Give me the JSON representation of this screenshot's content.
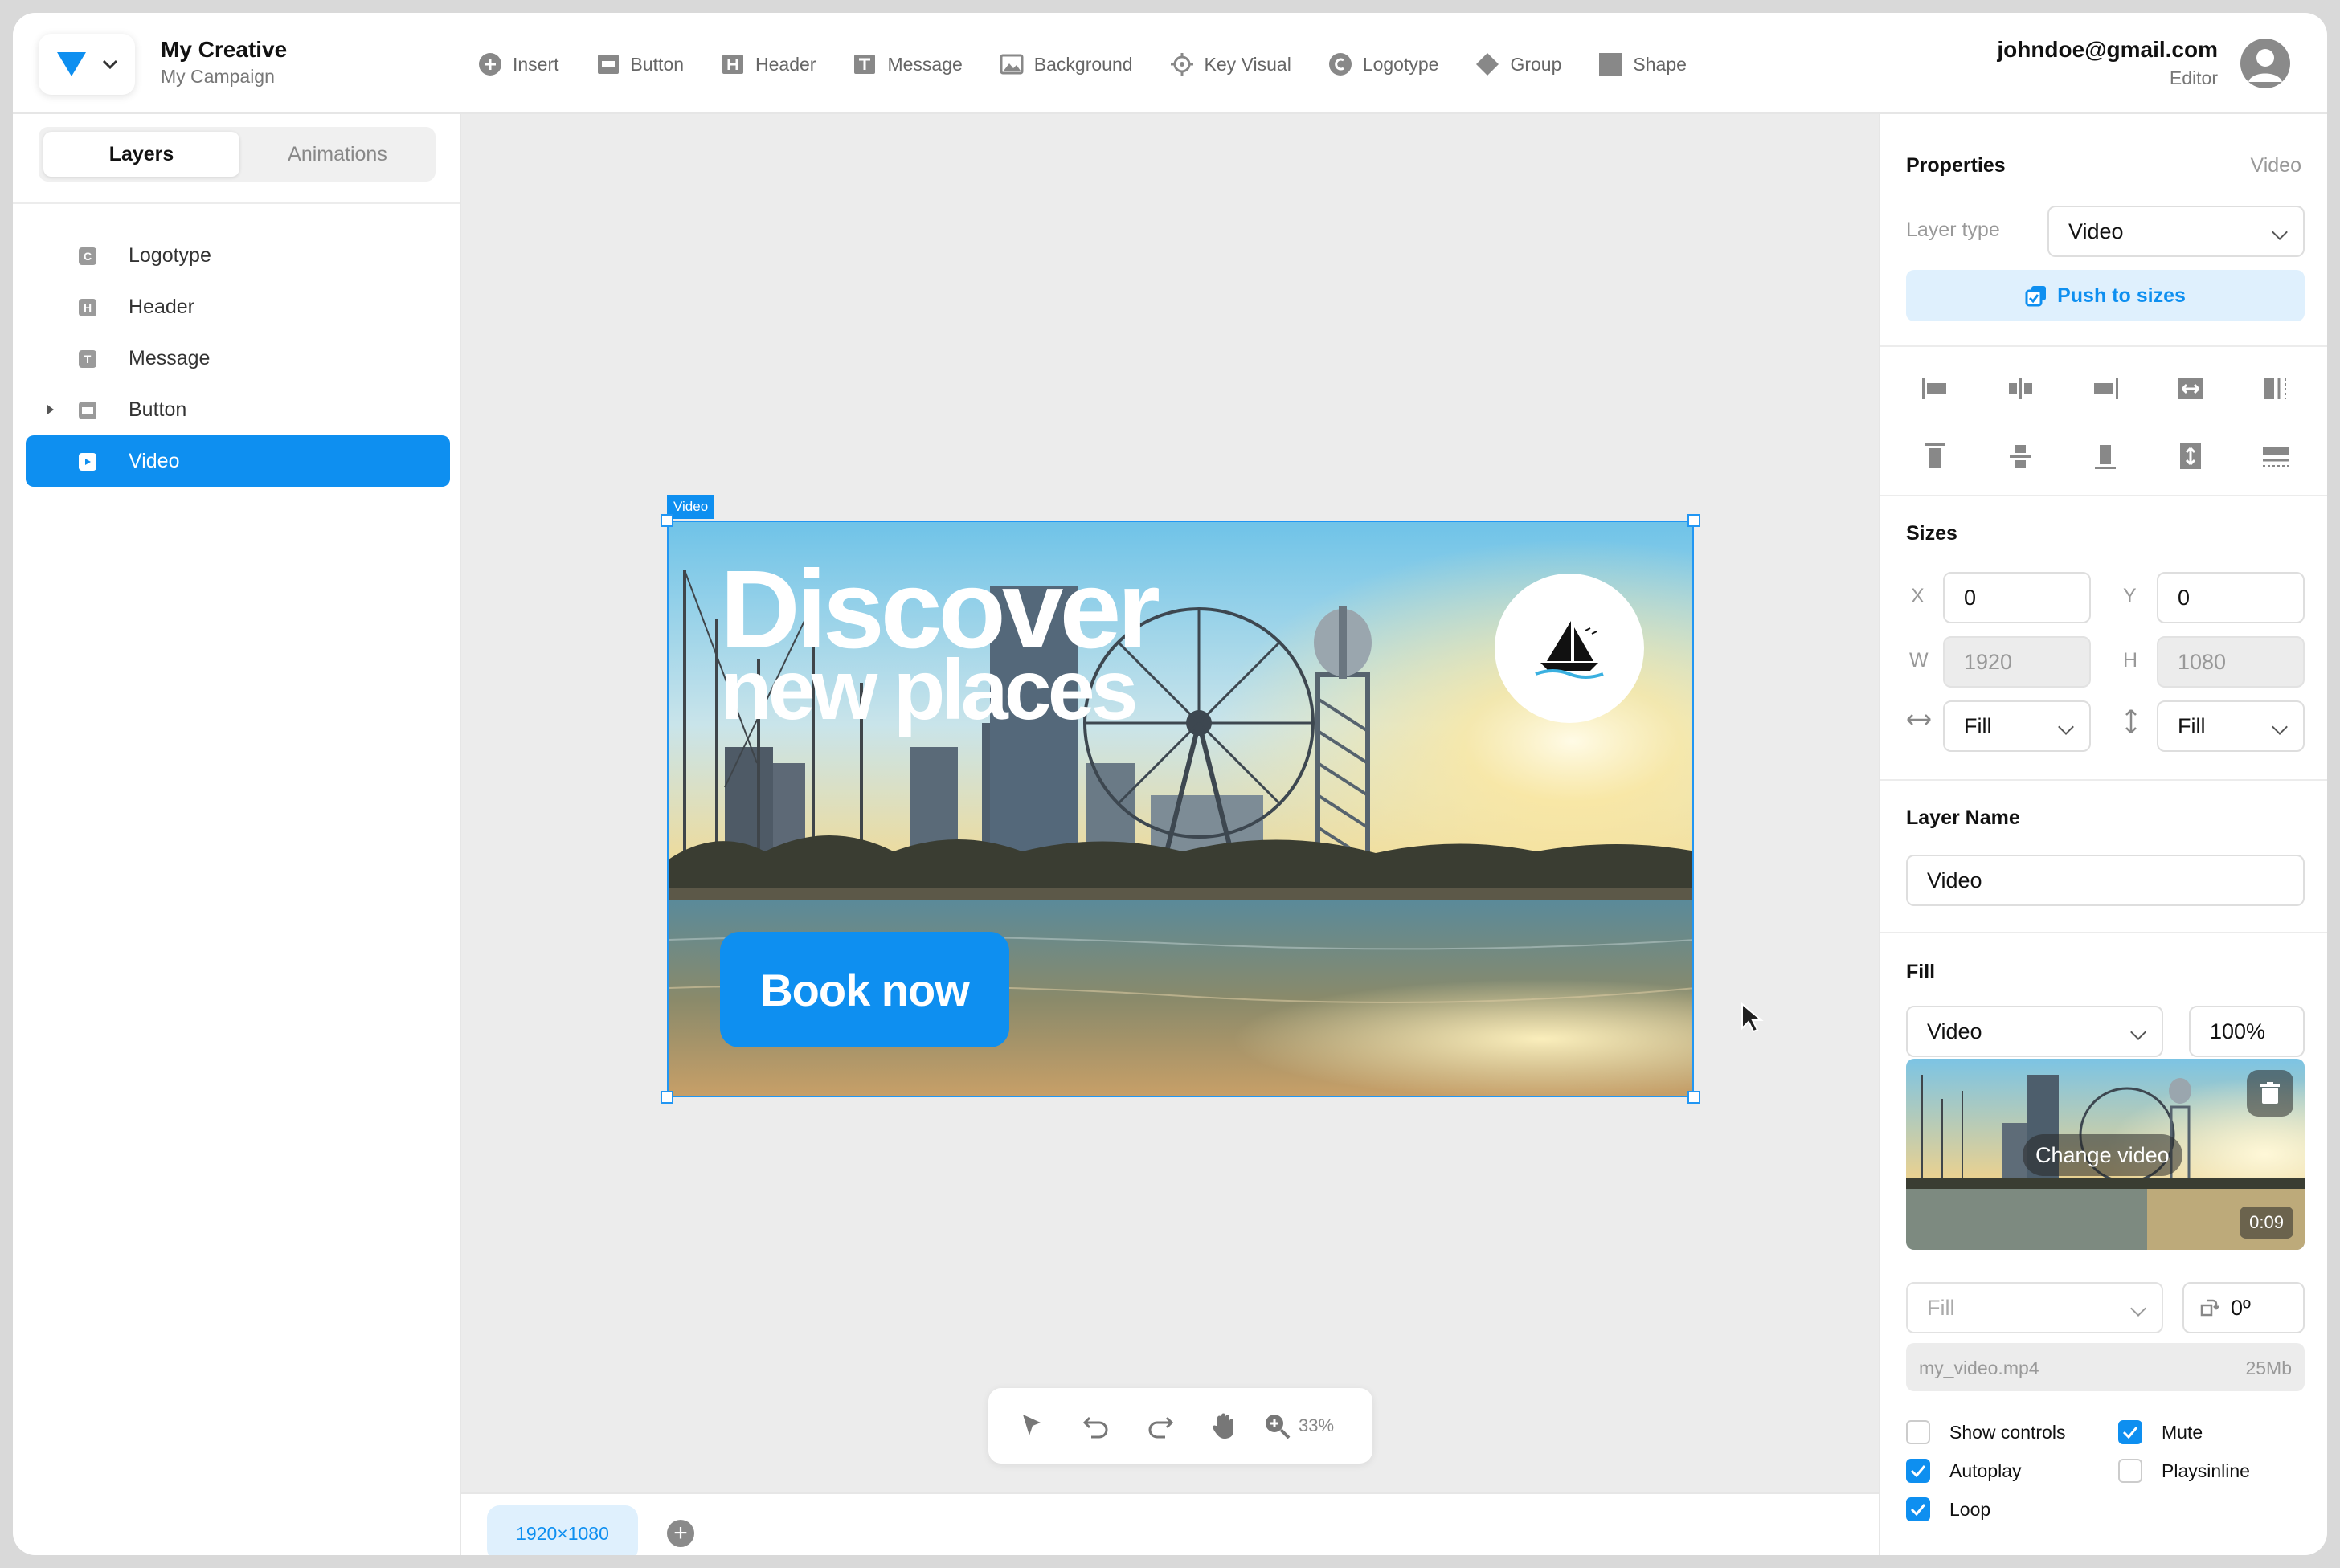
{
  "header": {
    "app_title": "My Creative",
    "app_subtitle": "My Campaign",
    "toolbar": [
      {
        "label": "Insert",
        "icon": "plus-circle-icon"
      },
      {
        "label": "Button",
        "icon": "button-icon"
      },
      {
        "label": "Header",
        "icon": "header-icon"
      },
      {
        "label": "Message",
        "icon": "text-icon"
      },
      {
        "label": "Background",
        "icon": "image-icon"
      },
      {
        "label": "Key Visual",
        "icon": "crosshair-icon"
      },
      {
        "label": "Logotype",
        "icon": "copyright-icon"
      },
      {
        "label": "Group",
        "icon": "diamond-icon"
      },
      {
        "label": "Shape",
        "icon": "square-icon"
      }
    ],
    "user_email": "johndoe@gmail.com",
    "user_role": "Editor"
  },
  "left_panel": {
    "tabs": [
      "Layers",
      "Animations"
    ],
    "active_tab": "Layers",
    "layers": [
      {
        "name": "Logotype",
        "icon": "C"
      },
      {
        "name": "Header",
        "icon": "H"
      },
      {
        "name": "Message",
        "icon": "T"
      },
      {
        "name": "Button",
        "icon": "B"
      },
      {
        "name": "Video",
        "icon": "▶"
      }
    ],
    "selected_layer": "Video"
  },
  "canvas": {
    "selection_tag": "Video",
    "headline_line1": "Discover",
    "headline_line2": "new places",
    "cta_label": "Book now",
    "zoom": "33%",
    "size_chip": "1920×1080"
  },
  "properties": {
    "title": "Properties",
    "type_hint": "Video",
    "layer_type_label": "Layer type",
    "layer_type_value": "Video",
    "push_button": "Push to sizes",
    "sizes_title": "Sizes",
    "x_label": "X",
    "x_value": "0",
    "y_label": "Y",
    "y_value": "0",
    "w_label": "W",
    "w_value": "1920",
    "h_label": "H",
    "h_value": "1080",
    "h_fit": "Fill",
    "v_fit": "Fill",
    "layer_name_title": "Layer Name",
    "layer_name_value": "Video",
    "fill_title": "Fill",
    "fill_type": "Video",
    "fill_opacity": "100%",
    "change_video": "Change video",
    "duration": "0:09",
    "fill_mode": "Fill",
    "rotation": "0º",
    "file_name": "my_video.mp4",
    "file_size": "25Mb",
    "options": [
      {
        "label": "Show controls",
        "checked": false
      },
      {
        "label": "Mute",
        "checked": true
      },
      {
        "label": "Autoplay",
        "checked": true
      },
      {
        "label": "Playsinline",
        "checked": false
      },
      {
        "label": "Loop",
        "checked": true
      }
    ]
  },
  "colors": {
    "accent": "#0e8ff0",
    "accent_light": "#dff0fd",
    "canvas_bg": "#ececec"
  }
}
